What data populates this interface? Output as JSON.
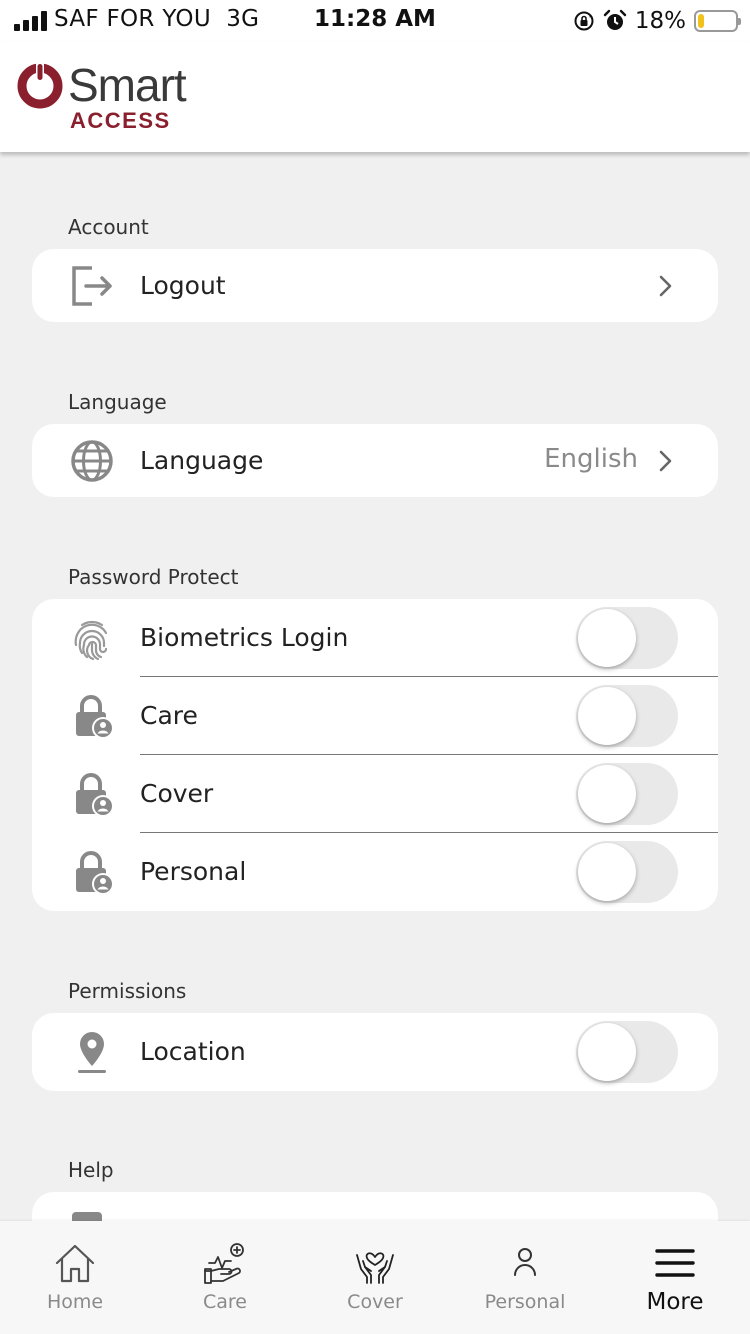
{
  "status_bar": {
    "carrier": "SAF FOR YOU",
    "network": "3G",
    "time": "11:28 AM",
    "battery": "18%",
    "battery_level": 0.18
  },
  "header": {
    "logo_word": "Smart",
    "logo_sub": "ACCESS",
    "brand_color": "#8a1f2d"
  },
  "sections": {
    "account": {
      "title": "Account",
      "logout": {
        "label": "Logout",
        "icon": "logout-icon"
      }
    },
    "language": {
      "title": "Language",
      "language": {
        "label": "Language",
        "value": "English",
        "icon": "globe-icon"
      }
    },
    "password_protect": {
      "title": "Password Protect",
      "items": [
        {
          "label": "Biometrics Login",
          "icon": "fingerprint-icon",
          "enabled": false
        },
        {
          "label": "Care",
          "icon": "lock-user-icon",
          "enabled": false
        },
        {
          "label": "Cover",
          "icon": "lock-user-icon",
          "enabled": false
        },
        {
          "label": "Personal",
          "icon": "lock-user-icon",
          "enabled": false
        }
      ]
    },
    "permissions": {
      "title": "Permissions",
      "location": {
        "label": "Location",
        "icon": "location-pin-icon",
        "enabled": false
      }
    },
    "help": {
      "title": "Help"
    }
  },
  "tabs": [
    {
      "label": "Home",
      "icon": "home-icon",
      "active": false
    },
    {
      "label": "Care",
      "icon": "care-icon",
      "active": false
    },
    {
      "label": "Cover",
      "icon": "cover-hands-heart-icon",
      "active": false
    },
    {
      "label": "Personal",
      "icon": "person-icon",
      "active": false
    },
    {
      "label": "More",
      "icon": "menu-icon",
      "active": true
    }
  ]
}
